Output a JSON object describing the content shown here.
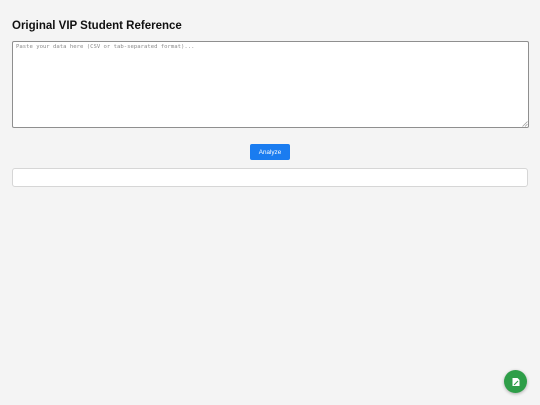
{
  "header": {
    "title": "Original VIP Student Reference"
  },
  "input": {
    "value": "",
    "placeholder": "Paste your data here (CSV or tab-separated format)..."
  },
  "actions": {
    "analyze_label": "Analyze"
  },
  "results": {
    "text": ""
  },
  "fab": {
    "icon": "edit-note-icon",
    "color": "#2e9e48"
  },
  "colors": {
    "accent": "#1a7cf0",
    "background": "#f4f4f4"
  }
}
